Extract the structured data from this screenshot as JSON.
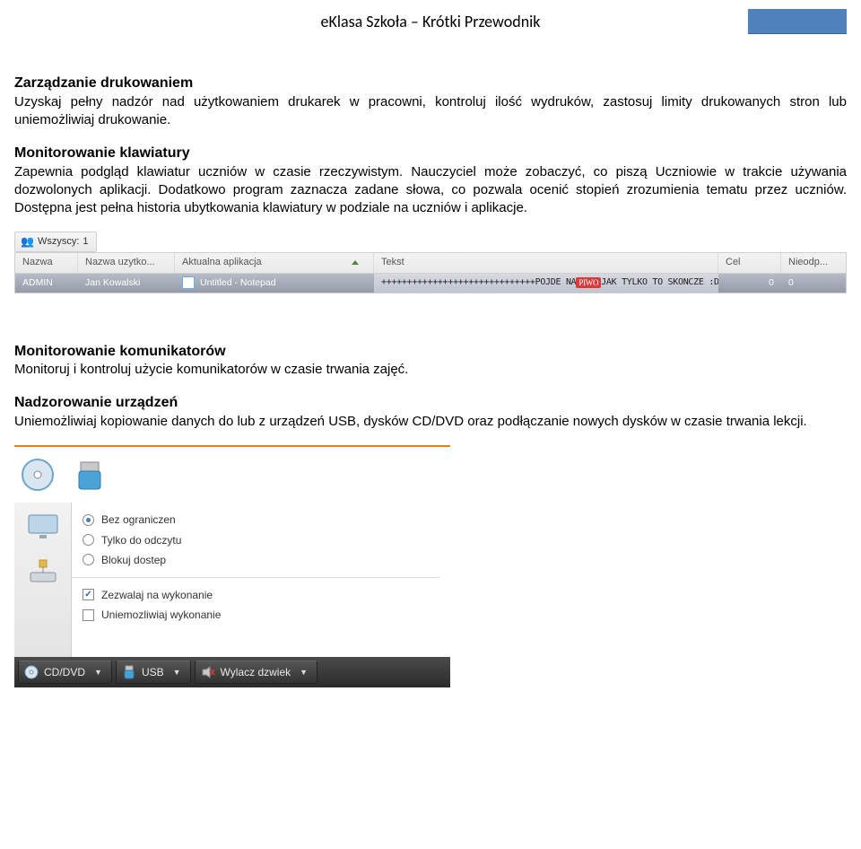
{
  "header": {
    "title": "eKlasa Szkoła – Krótki Przewodnik"
  },
  "sections": {
    "s1_title": "Zarządzanie drukowaniem",
    "s1_body": "Uzyskaj pełny nadzór nad użytkowaniem drukarek w pracowni, kontroluj ilość wydruków, zastosuj limity drukowanych stron lub uniemożliwiaj drukowanie.",
    "s2_title": "Monitorowanie klawiatury",
    "s2_body": "Zapewnia podgląd klawiatur uczniów w czasie rzeczywistym. Nauczyciel może zobaczyć, co piszą Uczniowie w trakcie używania dozwolonych aplikacji. Dodatkowo program zaznacza zadane słowa, co pozwala ocenić stopień zrozumienia tematu przez uczniów. ",
    "s2_body_italic": "Dostępna jest pełna historia ubytkowania klawiatury w podziale na uczniów i aplikacje.",
    "s3_title": "Monitorowanie komunikatorów",
    "s3_body": "Monitoruj i kontroluj użycie komunikatorów w czasie trwania zajęć.",
    "s4_title": "Nadzorowanie urządzeń",
    "s4_body": "Uniemożliwiaj kopiowanie danych do lub z urządzeń USB, dysków CD/DVD oraz podłączanie nowych dysków w czasie trwania lekcji."
  },
  "screenshot1": {
    "all_label": "Wszyscy:",
    "all_count": "1",
    "cols": {
      "nazwa": "Nazwa",
      "nazwauz": "Nazwa uzytko...",
      "app": "Aktualna aplikacja",
      "tekst": "Tekst",
      "cel": "Cel",
      "nieodp": "Nieodp..."
    },
    "row": {
      "nazwa": "ADMIN",
      "user": "Jan Kowalski",
      "app": "Untitled - Notepad",
      "text_prefix": "++++++++++++++++++++++++++++++POJDE NA ",
      "text_marked": "PIWO",
      "text_suffix": " JAK TYLKO TO SKONCZE :DPIWO",
      "cel": "0",
      "nieodp": "0"
    }
  },
  "screenshot2": {
    "radios": {
      "r1": "Bez ograniczen",
      "r2": "Tylko do odczytu",
      "r3": "Blokuj dostep"
    },
    "checks": {
      "c1": "Zezwalaj na wykonanie",
      "c2": "Uniemozliwiaj wykonanie"
    },
    "toolbar": {
      "cd": "CD/DVD",
      "usb": "USB",
      "mute": "Wylacz dzwiek"
    }
  }
}
